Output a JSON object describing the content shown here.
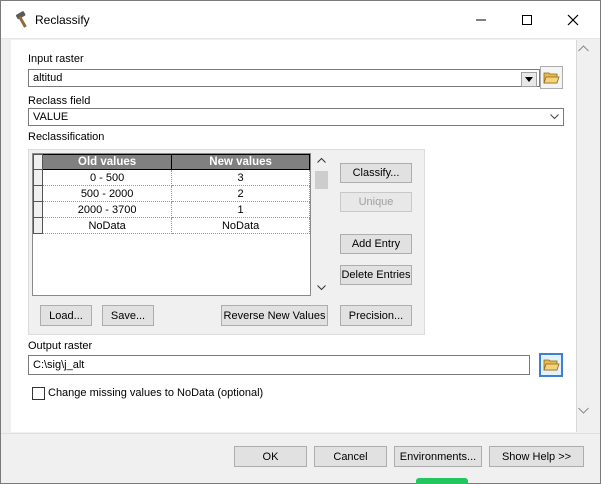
{
  "window": {
    "title": "Reclassify"
  },
  "input_raster": {
    "label": "Input raster",
    "value": "altitud"
  },
  "reclass_field": {
    "label": "Reclass field",
    "value": "VALUE"
  },
  "reclassification": {
    "label": "Reclassification",
    "columns": [
      "Old values",
      "New values"
    ],
    "rows": [
      {
        "old": "0 - 500",
        "new": "3"
      },
      {
        "old": "500 - 2000",
        "new": "2"
      },
      {
        "old": "2000 - 3700",
        "new": "1"
      },
      {
        "old": "NoData",
        "new": "NoData"
      }
    ],
    "buttons": {
      "classify": "Classify...",
      "unique": "Unique",
      "add_entry": "Add Entry",
      "delete_entries": "Delete Entries",
      "load": "Load...",
      "save": "Save...",
      "reverse": "Reverse New Values",
      "precision": "Precision..."
    }
  },
  "output_raster": {
    "label": "Output raster",
    "value": "C:\\sig\\j_alt"
  },
  "missing_values": {
    "label": "Change missing values to NoData (optional)",
    "checked": false
  },
  "footer": {
    "ok": "OK",
    "cancel": "Cancel",
    "environments": "Environments...",
    "show_help": "Show Help >>"
  },
  "colors": {
    "accent": "#3c7fd6",
    "folder": "#e8b84a",
    "header_bg": "#808080"
  },
  "icons": {
    "title": "hammer-icon",
    "browse": "folder-open-icon"
  }
}
